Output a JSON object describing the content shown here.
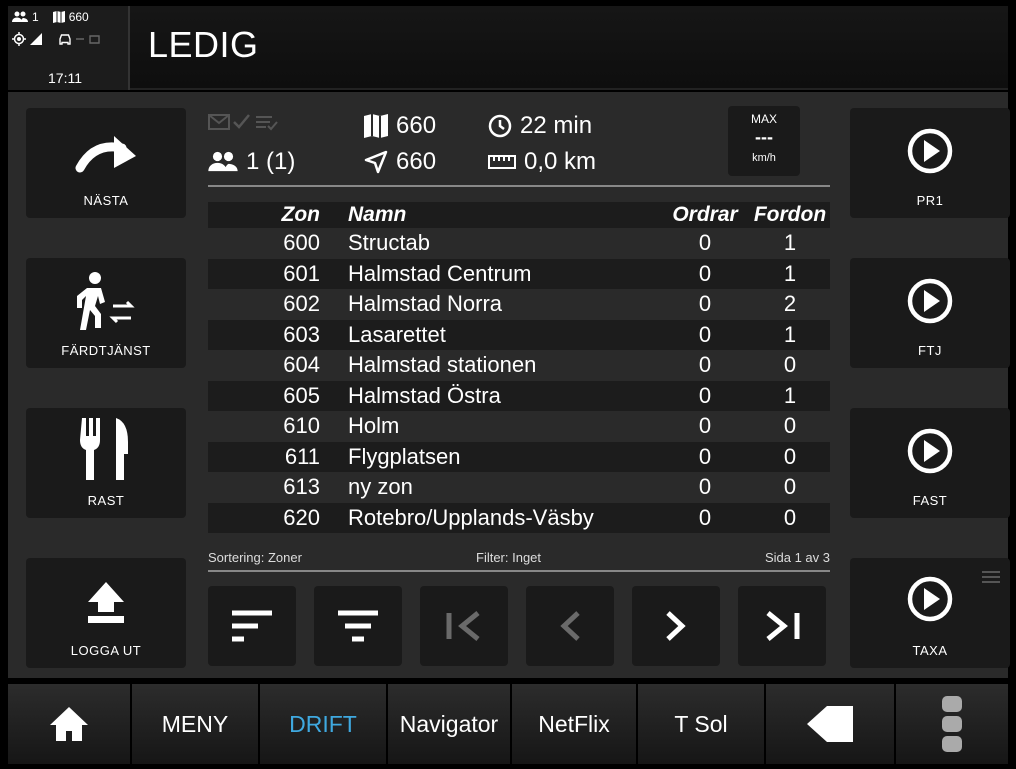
{
  "header": {
    "persons": "1",
    "zone": "660",
    "time": "17:11",
    "title": "LEDIG"
  },
  "left_buttons": [
    {
      "label": "NÄSTA",
      "icon": "redo-arrow-icon"
    },
    {
      "label": "FÄRDTJÄNST",
      "icon": "walking-person-icon"
    },
    {
      "label": "RAST",
      "icon": "utensils-icon"
    },
    {
      "label": "LOGGA UT",
      "icon": "upload-icon"
    }
  ],
  "right_buttons": [
    {
      "label": "PR1",
      "icon": "play-circle-icon"
    },
    {
      "label": "FTJ",
      "icon": "play-circle-icon"
    },
    {
      "label": "FAST",
      "icon": "play-circle-icon"
    },
    {
      "label": "TAXA",
      "icon": "play-circle-icon"
    }
  ],
  "info": {
    "zone": "660",
    "queue_time": "22 min",
    "persons": "1 (1)",
    "nav_zone": "660",
    "distance": "0,0 km",
    "max_label": "MAX",
    "max_value": "---",
    "max_unit": "km/h"
  },
  "table": {
    "headers": {
      "zon": "Zon",
      "namn": "Namn",
      "ordrar": "Ordrar",
      "fordon": "Fordon"
    },
    "rows": [
      {
        "zon": "600",
        "namn": "Structab",
        "ordrar": "0",
        "fordon": "1"
      },
      {
        "zon": "601",
        "namn": "Halmstad Centrum",
        "ordrar": "0",
        "fordon": "1"
      },
      {
        "zon": "602",
        "namn": "Halmstad Norra",
        "ordrar": "0",
        "fordon": "2"
      },
      {
        "zon": "603",
        "namn": "Lasarettet",
        "ordrar": "0",
        "fordon": "1"
      },
      {
        "zon": "604",
        "namn": "Halmstad stationen",
        "ordrar": "0",
        "fordon": "0"
      },
      {
        "zon": "605",
        "namn": "Halmstad Östra",
        "ordrar": "0",
        "fordon": "1"
      },
      {
        "zon": "610",
        "namn": "Holm",
        "ordrar": "0",
        "fordon": "0"
      },
      {
        "zon": "611",
        "namn": "Flygplatsen",
        "ordrar": "0",
        "fordon": "0"
      },
      {
        "zon": "613",
        "namn": "ny zon",
        "ordrar": "0",
        "fordon": "0"
      },
      {
        "zon": "620",
        "namn": "Rotebro/Upplands-Väsby",
        "ordrar": "0",
        "fordon": "0"
      }
    ]
  },
  "footer": {
    "sort": "Sortering: Zoner",
    "filter": "Filter: Inget",
    "page": "Sida 1 av 3"
  },
  "tabs": [
    {
      "label": "",
      "icon": "home-icon"
    },
    {
      "label": "MENY"
    },
    {
      "label": "DRIFT",
      "active": true
    },
    {
      "label": "Navigator"
    },
    {
      "label": "NetFlix"
    },
    {
      "label": "T Sol"
    },
    {
      "label": "",
      "icon": "back-arrow-icon"
    },
    {
      "label": "",
      "icon": "more-vertical-icon"
    }
  ],
  "colors": {
    "active_tab": "#3fa9e0",
    "panel": "#2a2a2a",
    "button": "#1a1a1a"
  }
}
